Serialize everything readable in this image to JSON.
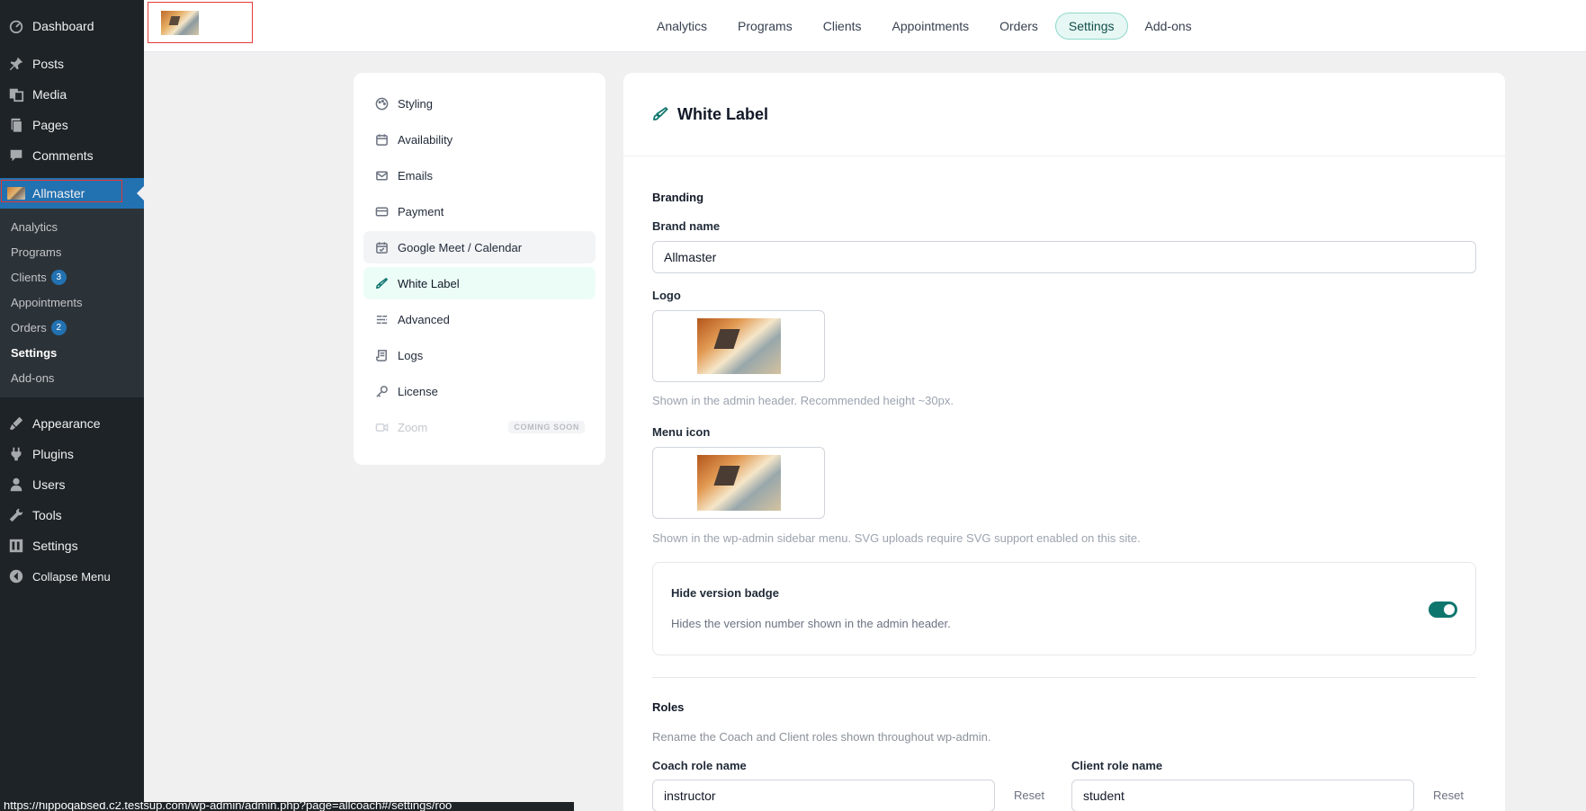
{
  "wp_menu": {
    "top": [
      {
        "label": "Dashboard",
        "icon": "dashboard-icon"
      },
      {
        "label": "Posts",
        "icon": "pin-icon"
      },
      {
        "label": "Media",
        "icon": "media-icon"
      },
      {
        "label": "Pages",
        "icon": "pages-icon"
      },
      {
        "label": "Comments",
        "icon": "comment-icon"
      }
    ],
    "active": {
      "label": "Allmaster"
    },
    "submenu": [
      {
        "label": "Analytics"
      },
      {
        "label": "Programs"
      },
      {
        "label": "Clients",
        "badge": "3"
      },
      {
        "label": "Appointments"
      },
      {
        "label": "Orders",
        "badge": "2"
      },
      {
        "label": "Settings"
      },
      {
        "label": "Add-ons"
      }
    ],
    "bottom": [
      {
        "label": "Appearance",
        "icon": "brush-icon"
      },
      {
        "label": "Plugins",
        "icon": "plugin-icon"
      },
      {
        "label": "Users",
        "icon": "user-icon"
      },
      {
        "label": "Tools",
        "icon": "wrench-icon"
      },
      {
        "label": "Settings",
        "icon": "settings-icon"
      },
      {
        "label": "Collapse Menu",
        "icon": "collapse-icon"
      }
    ]
  },
  "topnav": {
    "items": [
      "Analytics",
      "Programs",
      "Clients",
      "Appointments",
      "Orders",
      "Settings",
      "Add-ons"
    ],
    "active": "Settings"
  },
  "settings_nav": {
    "items": [
      {
        "label": "Styling"
      },
      {
        "label": "Availability"
      },
      {
        "label": "Emails"
      },
      {
        "label": "Payment"
      },
      {
        "label": "Google Meet / Calendar"
      },
      {
        "label": "White Label"
      },
      {
        "label": "Advanced"
      },
      {
        "label": "Logs"
      },
      {
        "label": "License"
      },
      {
        "label": "Zoom",
        "tag": "COMING SOON"
      }
    ]
  },
  "panel": {
    "title": "White Label",
    "branding": {
      "section": "Branding",
      "brand_name_label": "Brand name",
      "brand_name_value": "Allmaster",
      "logo_label": "Logo",
      "logo_hint": "Shown in the admin header. Recommended height ~30px.",
      "menu_icon_label": "Menu icon",
      "menu_icon_hint": "Shown in the wp-admin sidebar menu. SVG uploads require SVG support enabled on this site."
    },
    "version_badge": {
      "title": "Hide version badge",
      "desc": "Hides the version number shown in the admin header.",
      "enabled": true
    },
    "roles": {
      "section": "Roles",
      "desc": "Rename the Coach and Client roles shown throughout wp-admin.",
      "coach_label": "Coach role name",
      "coach_value": "instructor",
      "client_label": "Client role name",
      "client_value": "student",
      "reset_label": "Reset"
    }
  },
  "status_url": "https://hippoqabsed.c2.testsup.com/wp-admin/admin.php?page=allcoach#/settings/roo"
}
